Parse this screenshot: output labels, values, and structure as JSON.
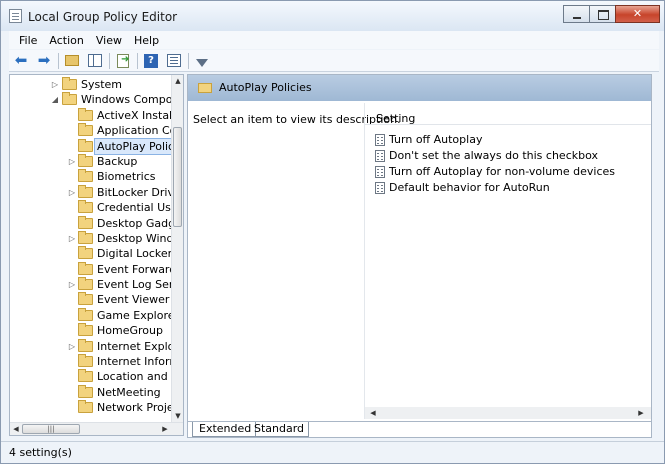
{
  "window": {
    "title": "Local Group Policy Editor"
  },
  "menu": [
    "File",
    "Action",
    "View",
    "Help"
  ],
  "tree": {
    "items": [
      {
        "label": "System",
        "level": 1,
        "expander": "▷",
        "selected": false
      },
      {
        "label": "Windows Compone",
        "level": 1,
        "expander": "◢",
        "selected": false
      },
      {
        "label": "ActiveX Installer",
        "level": 2,
        "expander": "",
        "selected": false
      },
      {
        "label": "Application Cor",
        "level": 2,
        "expander": "",
        "selected": false
      },
      {
        "label": "AutoPlay Policie",
        "level": 2,
        "expander": "",
        "selected": true
      },
      {
        "label": "Backup",
        "level": 2,
        "expander": "▷",
        "selected": false
      },
      {
        "label": "Biometrics",
        "level": 2,
        "expander": "",
        "selected": false
      },
      {
        "label": "BitLocker Drive I",
        "level": 2,
        "expander": "▷",
        "selected": false
      },
      {
        "label": "Credential User I",
        "level": 2,
        "expander": "",
        "selected": false
      },
      {
        "label": "Desktop Gadget",
        "level": 2,
        "expander": "",
        "selected": false
      },
      {
        "label": "Desktop Windov",
        "level": 2,
        "expander": "▷",
        "selected": false
      },
      {
        "label": "Digital Locker",
        "level": 2,
        "expander": "",
        "selected": false
      },
      {
        "label": "Event Forwardin",
        "level": 2,
        "expander": "",
        "selected": false
      },
      {
        "label": "Event Log Servic",
        "level": 2,
        "expander": "▷",
        "selected": false
      },
      {
        "label": "Event Viewer",
        "level": 2,
        "expander": "",
        "selected": false
      },
      {
        "label": "Game Explorer",
        "level": 2,
        "expander": "",
        "selected": false
      },
      {
        "label": "HomeGroup",
        "level": 2,
        "expander": "",
        "selected": false
      },
      {
        "label": "Internet Explorer",
        "level": 2,
        "expander": "▷",
        "selected": false
      },
      {
        "label": "Internet Informa",
        "level": 2,
        "expander": "",
        "selected": false
      },
      {
        "label": "Location and Se",
        "level": 2,
        "expander": "",
        "selected": false
      },
      {
        "label": "NetMeeting",
        "level": 2,
        "expander": "",
        "selected": false
      },
      {
        "label": "Network Project",
        "level": 2,
        "expander": "",
        "selected": false
      }
    ]
  },
  "details": {
    "header": "AutoPlay Policies",
    "description": "Select an item to view its description.",
    "column": "Setting",
    "settings": [
      "Turn off Autoplay",
      "Don't set the always do this checkbox",
      "Turn off Autoplay for non-volume devices",
      "Default behavior for AutoRun"
    ]
  },
  "tabs": {
    "extended": "Extended",
    "standard": "Standard"
  },
  "status": {
    "text": "4 setting(s)"
  },
  "icons": {
    "back": "back-arrow-icon",
    "forward": "forward-arrow-icon",
    "up": "up-folder-icon",
    "tree": "show-hide-tree-icon",
    "export": "export-list-icon",
    "help": "help-icon",
    "properties": "properties-icon",
    "filter": "filter-icon",
    "help_glyph": "?"
  }
}
